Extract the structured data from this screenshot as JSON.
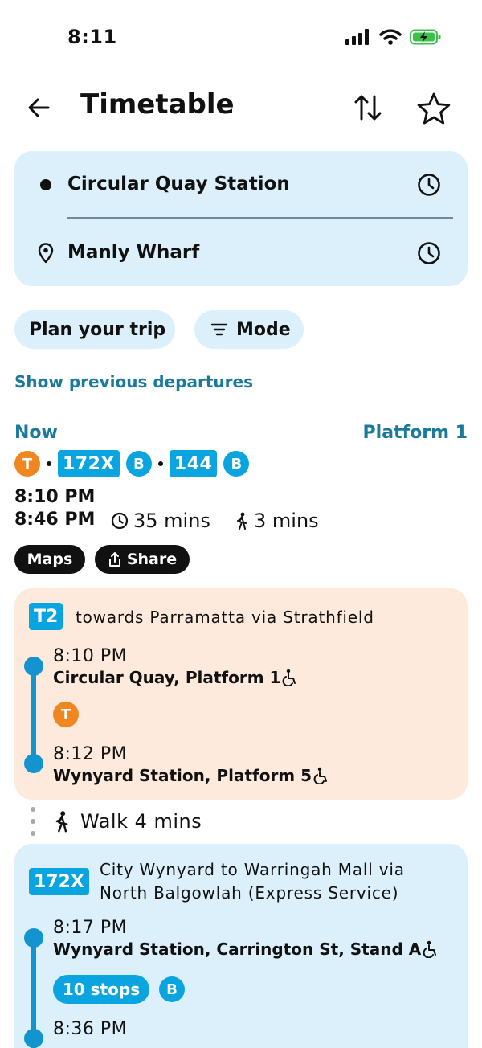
{
  "status_bar": {
    "time": "8:11"
  },
  "header": {
    "title": "Timetable"
  },
  "route": {
    "origin": "Circular Quay Station",
    "destination": "Manly Wharf"
  },
  "chips": {
    "plan_trip": "Plan your trip",
    "mode": "Mode"
  },
  "show_previous": "Show previous departures",
  "trip": {
    "when": "Now",
    "platform": "Platform 1",
    "mode_badges": [
      {
        "label": "T",
        "color": "#f0861f"
      },
      {
        "route": "172X",
        "sub": "B"
      },
      {
        "route": "144",
        "sub": "B"
      }
    ],
    "depart": "8:10 PM",
    "arrive": "8:46 PM",
    "duration": "35 mins",
    "walk": "3 mins",
    "maps_label": "Maps",
    "share_label": "Share"
  },
  "legs": [
    {
      "line": "T2",
      "heading": "towards Parramatta via Strathfield",
      "color": "#fdeadc",
      "from_time": "8:10 PM",
      "from_stop": "Circular Quay, Platform 1",
      "mode_icon": "T",
      "to_time": "8:12 PM",
      "to_stop": "Wynyard Station, Platform 5"
    },
    {
      "walk": "Walk 4 mins"
    },
    {
      "line": "172X",
      "heading_line1": "City Wynyard to Warringah Mall via",
      "heading_line2": "North Balgowlah (Express Service)",
      "color": "#dbf0fa",
      "from_time": "8:17 PM",
      "from_stop": "Wynyard Station, Carrington St, Stand A",
      "stops": "10 stops",
      "mode_icon": "B",
      "to_time": "8:36 PM"
    }
  ],
  "colors": {
    "accent_blue": "#1a7a9e",
    "bus_blue": "#0aa5e0",
    "train_orange": "#f0861f",
    "card_blue": "#dbf0fa",
    "card_orange": "#fdeadc"
  }
}
